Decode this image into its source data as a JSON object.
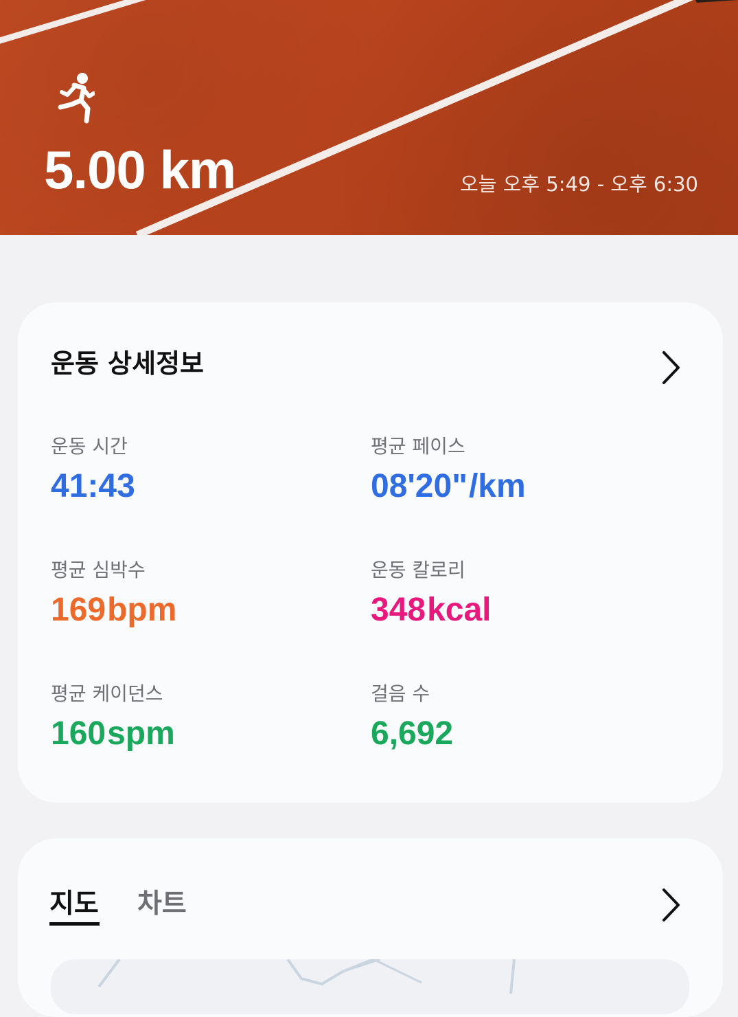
{
  "header": {
    "distance": "5.00 km",
    "time_range": "오늘 오후 5:49 - 오후 6:30",
    "icon": "running-person-icon"
  },
  "details_card": {
    "title": "운동 상세정보",
    "icon": "chevron-right-icon",
    "stats": [
      {
        "label": "운동 시간",
        "value": "41:43",
        "unit": "",
        "color": "#2f6de0"
      },
      {
        "label": "평균 페이스",
        "value": "08'20\"",
        "unit": "/km",
        "color": "#2f6de0"
      },
      {
        "label": "평균 심박수",
        "value": "169",
        "unit": "bpm",
        "color": "#ec6a2c"
      },
      {
        "label": "운동 칼로리",
        "value": "348",
        "unit": "kcal",
        "color": "#e8197d"
      },
      {
        "label": "평균 케이던스",
        "value": "160",
        "unit": "spm",
        "color": "#1aa85c"
      },
      {
        "label": "걸음 수",
        "value": "6,692",
        "unit": "",
        "color": "#1aa85c"
      }
    ]
  },
  "map_card": {
    "tabs": [
      {
        "label": "지도",
        "selected": true
      },
      {
        "label": "차트",
        "selected": false
      }
    ],
    "icon": "chevron-right-icon"
  },
  "colors": {
    "track_orange": "#b8431d",
    "background": "#f2f2f4",
    "card": "#fafbfd"
  }
}
